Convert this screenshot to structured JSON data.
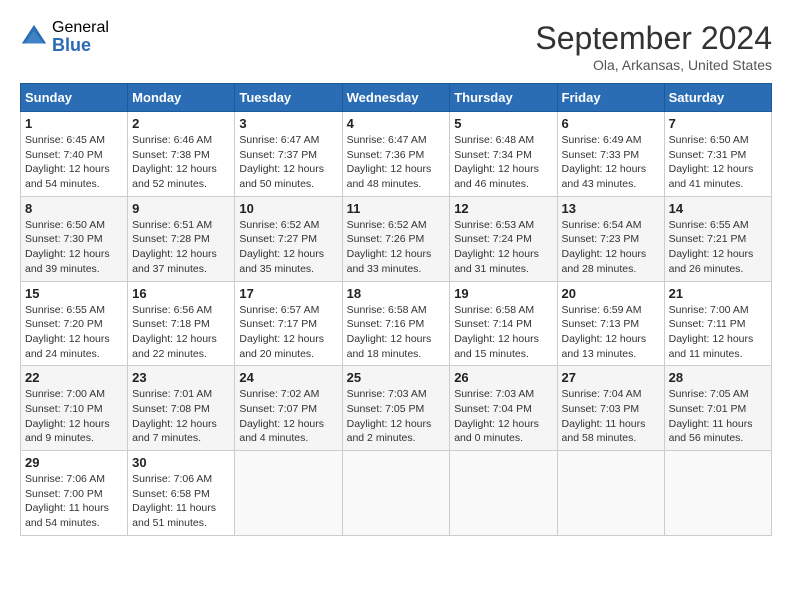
{
  "header": {
    "logo_general": "General",
    "logo_blue": "Blue",
    "month_title": "September 2024",
    "subtitle": "Ola, Arkansas, United States"
  },
  "weekdays": [
    "Sunday",
    "Monday",
    "Tuesday",
    "Wednesday",
    "Thursday",
    "Friday",
    "Saturday"
  ],
  "weeks": [
    [
      {
        "day": "1",
        "sunrise": "6:45 AM",
        "sunset": "7:40 PM",
        "daylight": "12 hours and 54 minutes."
      },
      {
        "day": "2",
        "sunrise": "6:46 AM",
        "sunset": "7:38 PM",
        "daylight": "12 hours and 52 minutes."
      },
      {
        "day": "3",
        "sunrise": "6:47 AM",
        "sunset": "7:37 PM",
        "daylight": "12 hours and 50 minutes."
      },
      {
        "day": "4",
        "sunrise": "6:47 AM",
        "sunset": "7:36 PM",
        "daylight": "12 hours and 48 minutes."
      },
      {
        "day": "5",
        "sunrise": "6:48 AM",
        "sunset": "7:34 PM",
        "daylight": "12 hours and 46 minutes."
      },
      {
        "day": "6",
        "sunrise": "6:49 AM",
        "sunset": "7:33 PM",
        "daylight": "12 hours and 43 minutes."
      },
      {
        "day": "7",
        "sunrise": "6:50 AM",
        "sunset": "7:31 PM",
        "daylight": "12 hours and 41 minutes."
      }
    ],
    [
      {
        "day": "8",
        "sunrise": "6:50 AM",
        "sunset": "7:30 PM",
        "daylight": "12 hours and 39 minutes."
      },
      {
        "day": "9",
        "sunrise": "6:51 AM",
        "sunset": "7:28 PM",
        "daylight": "12 hours and 37 minutes."
      },
      {
        "day": "10",
        "sunrise": "6:52 AM",
        "sunset": "7:27 PM",
        "daylight": "12 hours and 35 minutes."
      },
      {
        "day": "11",
        "sunrise": "6:52 AM",
        "sunset": "7:26 PM",
        "daylight": "12 hours and 33 minutes."
      },
      {
        "day": "12",
        "sunrise": "6:53 AM",
        "sunset": "7:24 PM",
        "daylight": "12 hours and 31 minutes."
      },
      {
        "day": "13",
        "sunrise": "6:54 AM",
        "sunset": "7:23 PM",
        "daylight": "12 hours and 28 minutes."
      },
      {
        "day": "14",
        "sunrise": "6:55 AM",
        "sunset": "7:21 PM",
        "daylight": "12 hours and 26 minutes."
      }
    ],
    [
      {
        "day": "15",
        "sunrise": "6:55 AM",
        "sunset": "7:20 PM",
        "daylight": "12 hours and 24 minutes."
      },
      {
        "day": "16",
        "sunrise": "6:56 AM",
        "sunset": "7:18 PM",
        "daylight": "12 hours and 22 minutes."
      },
      {
        "day": "17",
        "sunrise": "6:57 AM",
        "sunset": "7:17 PM",
        "daylight": "12 hours and 20 minutes."
      },
      {
        "day": "18",
        "sunrise": "6:58 AM",
        "sunset": "7:16 PM",
        "daylight": "12 hours and 18 minutes."
      },
      {
        "day": "19",
        "sunrise": "6:58 AM",
        "sunset": "7:14 PM",
        "daylight": "12 hours and 15 minutes."
      },
      {
        "day": "20",
        "sunrise": "6:59 AM",
        "sunset": "7:13 PM",
        "daylight": "12 hours and 13 minutes."
      },
      {
        "day": "21",
        "sunrise": "7:00 AM",
        "sunset": "7:11 PM",
        "daylight": "12 hours and 11 minutes."
      }
    ],
    [
      {
        "day": "22",
        "sunrise": "7:00 AM",
        "sunset": "7:10 PM",
        "daylight": "12 hours and 9 minutes."
      },
      {
        "day": "23",
        "sunrise": "7:01 AM",
        "sunset": "7:08 PM",
        "daylight": "12 hours and 7 minutes."
      },
      {
        "day": "24",
        "sunrise": "7:02 AM",
        "sunset": "7:07 PM",
        "daylight": "12 hours and 4 minutes."
      },
      {
        "day": "25",
        "sunrise": "7:03 AM",
        "sunset": "7:05 PM",
        "daylight": "12 hours and 2 minutes."
      },
      {
        "day": "26",
        "sunrise": "7:03 AM",
        "sunset": "7:04 PM",
        "daylight": "12 hours and 0 minutes."
      },
      {
        "day": "27",
        "sunrise": "7:04 AM",
        "sunset": "7:03 PM",
        "daylight": "11 hours and 58 minutes."
      },
      {
        "day": "28",
        "sunrise": "7:05 AM",
        "sunset": "7:01 PM",
        "daylight": "11 hours and 56 minutes."
      }
    ],
    [
      {
        "day": "29",
        "sunrise": "7:06 AM",
        "sunset": "7:00 PM",
        "daylight": "11 hours and 54 minutes."
      },
      {
        "day": "30",
        "sunrise": "7:06 AM",
        "sunset": "6:58 PM",
        "daylight": "11 hours and 51 minutes."
      },
      null,
      null,
      null,
      null,
      null
    ]
  ]
}
